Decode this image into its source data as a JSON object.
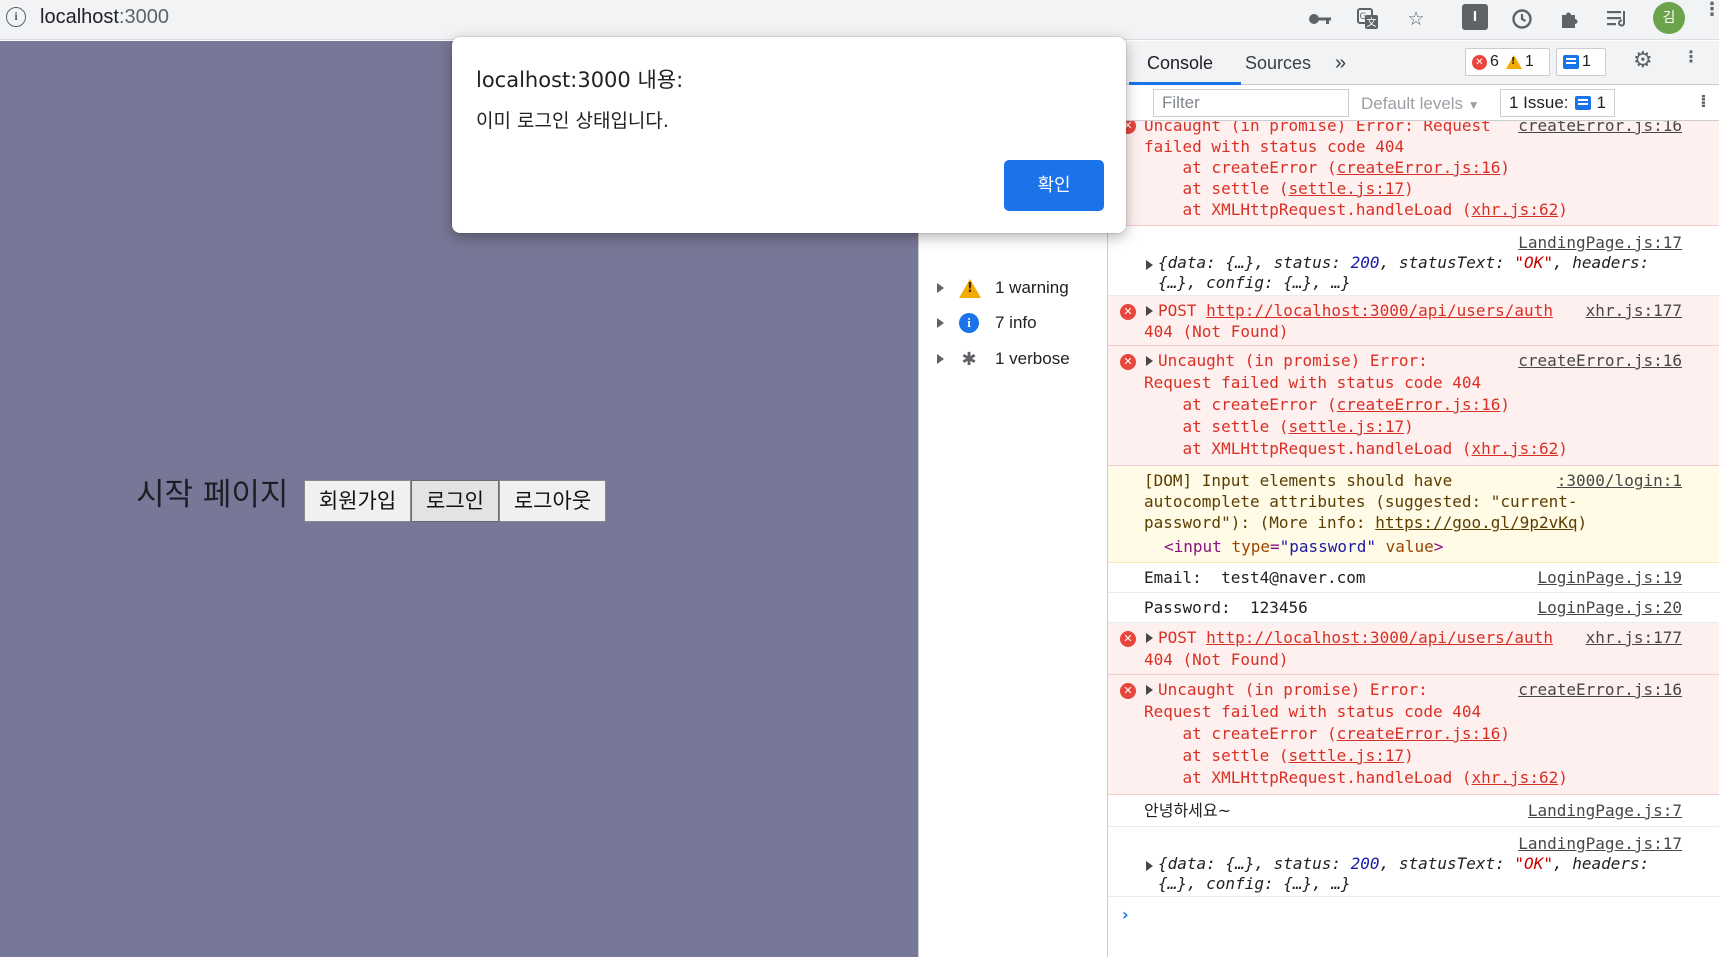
{
  "browser": {
    "url_host": "localhost",
    "url_port": ":3000",
    "avatar_initial": "김",
    "toolbar_icons": [
      "key-icon",
      "translate-icon",
      "star-icon",
      "extension-square-icon",
      "sync-icon",
      "puzzle-icon",
      "reading-list-icon",
      "profile-avatar",
      "menu-icon"
    ]
  },
  "page": {
    "title": "시작 페이지",
    "buttons": [
      {
        "label": "회원가입"
      },
      {
        "label": "로그인"
      },
      {
        "label": "로그아웃"
      }
    ],
    "background_color": "#777797"
  },
  "alert": {
    "title": "localhost:3000 내용:",
    "message": "이미 로그인 상태입니다.",
    "ok_label": "확인",
    "accent_color": "#1a73e8"
  },
  "devtools": {
    "tabs": [
      {
        "label": "Console",
        "active": true
      },
      {
        "label": "Sources",
        "active": false
      }
    ],
    "more_tabs_label": "»",
    "error_count": "6",
    "warning_count": "1",
    "message_count": "1",
    "filter_placeholder": "Filter",
    "levels_label": "Default levels",
    "issues_label": "1 Issue:",
    "issues_count": "1",
    "sidebar": [
      {
        "label": "1 warning",
        "icon": "warning-icon"
      },
      {
        "label": "7 info",
        "icon": "info-icon"
      },
      {
        "label": "1 verbose",
        "icon": "bug-icon"
      }
    ],
    "console": {
      "m1": {
        "l1": "Uncaught (in promise) Error: Request",
        "l2": "failed with status code 404",
        "src": "createError.js:16",
        "s1_pre": "    at createError (",
        "s1_link": "createError.js:16",
        "s1_post": ")",
        "s2_pre": "    at settle (",
        "s2_link": "settle.js:17",
        "s2_post": ")",
        "s3_pre": "    at XMLHttpRequest.handleLoad (",
        "s3_link": "xhr.js:62",
        "s3_post": ")"
      },
      "m2": {
        "src": "LandingPage.js:17",
        "o_a": "{data: {…}, status: ",
        "o_b": "200",
        "o_c": ", statusText: ",
        "o_d": "\"OK\"",
        "o_e": ", headers:",
        "l2": "{…}, config: {…}, …}"
      },
      "m3": {
        "pre": "POST ",
        "url": "http://localhost:3000/api/users/auth",
        "l2": "404 (Not Found)",
        "src": "xhr.js:177"
      },
      "m4": {
        "l1": "Uncaught (in promise) Error:",
        "l2": "Request failed with status code 404",
        "src": "createError.js:16",
        "s1_pre": "    at createError (",
        "s1_link": "createError.js:16",
        "s1_post": ")",
        "s2_pre": "    at settle (",
        "s2_link": "settle.js:17",
        "s2_post": ")",
        "s3_pre": "    at XMLHttpRequest.handleLoad (",
        "s3_link": "xhr.js:62",
        "s3_post": ")"
      },
      "m5": {
        "l1": "[DOM] Input elements should have",
        "l2": "autocomplete attributes (suggested: \"current-",
        "l3_pre": "password\"): (More info: ",
        "l3_link": "https://goo.gl/9p2vKq",
        "l3_post": ")",
        "h_lt": "<",
        "h_tag": "input",
        "h_attr": " type",
        "h_eq": "=",
        "h_val": "\"password\"",
        "h_attr2": " value",
        "h_gt": ">",
        "src": ":3000/login:1"
      },
      "m6": {
        "text": "Email:  test4@naver.com",
        "src": "LoginPage.js:19"
      },
      "m7": {
        "text": "Password:  123456",
        "src": "LoginPage.js:20"
      },
      "m8": {
        "pre": "POST ",
        "url": "http://localhost:3000/api/users/auth",
        "l2": "404 (Not Found)",
        "src": "xhr.js:177"
      },
      "m9": {
        "l1": "Uncaught (in promise) Error:",
        "l2": "Request failed with status code 404",
        "src": "createError.js:16",
        "s1_pre": "    at createError (",
        "s1_link": "createError.js:16",
        "s1_post": ")",
        "s2_pre": "    at settle (",
        "s2_link": "settle.js:17",
        "s2_post": ")",
        "s3_pre": "    at XMLHttpRequest.handleLoad (",
        "s3_link": "xhr.js:62",
        "s3_post": ")"
      },
      "m10": {
        "text": "안녕하세요~",
        "src": "LandingPage.js:7"
      },
      "m11": {
        "src": "LandingPage.js:17",
        "o_a": "{data: {…}, status: ",
        "o_b": "200",
        "o_c": ", statusText: ",
        "o_d": "\"OK\"",
        "o_e": ", headers:",
        "l2": "{…}, config: {…}, …}"
      },
      "prompt": "›"
    }
  }
}
